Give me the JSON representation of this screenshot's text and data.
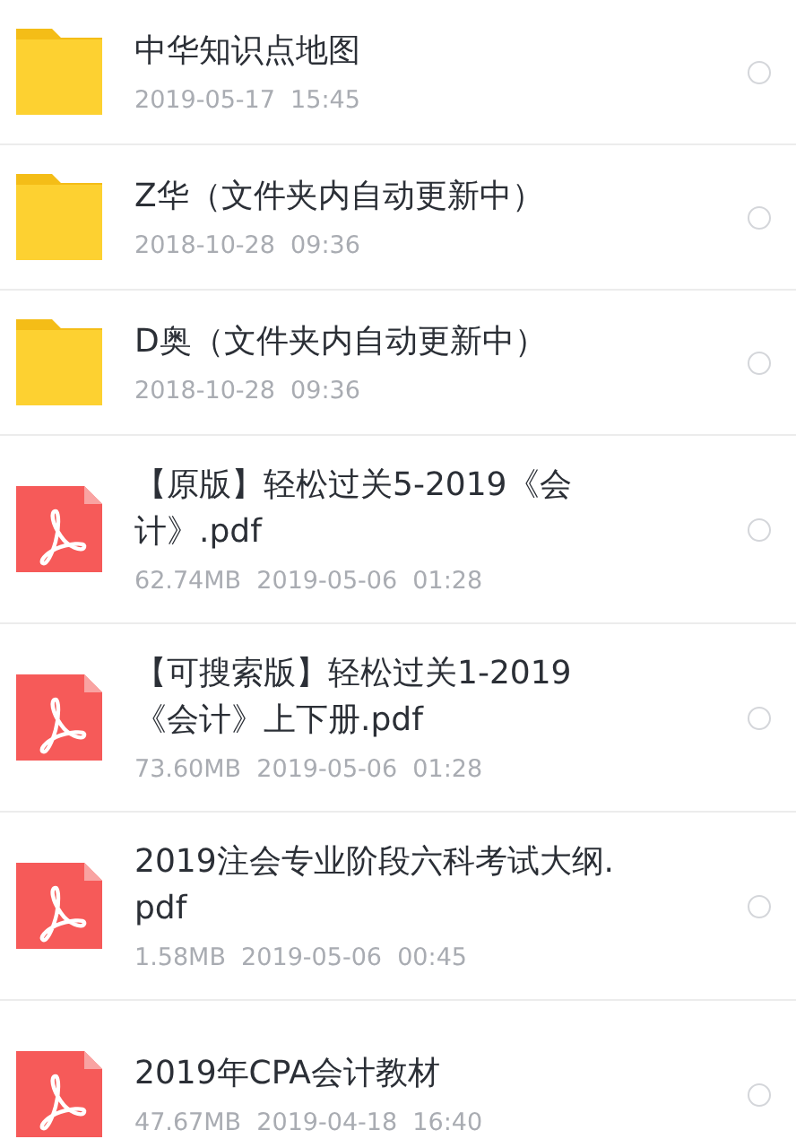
{
  "files": [
    {
      "kind": "folder",
      "name": "中华知识点地图",
      "meta": "2019-05-17  15:45",
      "selected": false
    },
    {
      "kind": "folder",
      "name": "Z华（文件夹内自动更新中）",
      "meta": "2018-10-28  09:36",
      "selected": false
    },
    {
      "kind": "folder",
      "name": "D奥（文件夹内自动更新中）",
      "meta": "2018-10-28  09:36",
      "selected": false
    },
    {
      "kind": "pdf",
      "name": "【原版】轻松过关5-2019《会计》.pdf",
      "meta": "62.74MB  2019-05-06  01:28",
      "selected": false
    },
    {
      "kind": "pdf",
      "name": "【可搜索版】轻松过关1-2019《会计》上下册.pdf",
      "meta": "73.60MB  2019-05-06  01:28",
      "selected": false
    },
    {
      "kind": "pdf",
      "name": "2019注会专业阶段六科考试大纲.pdf",
      "meta": "1.58MB  2019-05-06  00:45",
      "selected": false
    },
    {
      "kind": "pdf",
      "name": "2019年CPA会计教材",
      "meta": "47.67MB  2019-04-18  16:40",
      "selected": false
    }
  ]
}
